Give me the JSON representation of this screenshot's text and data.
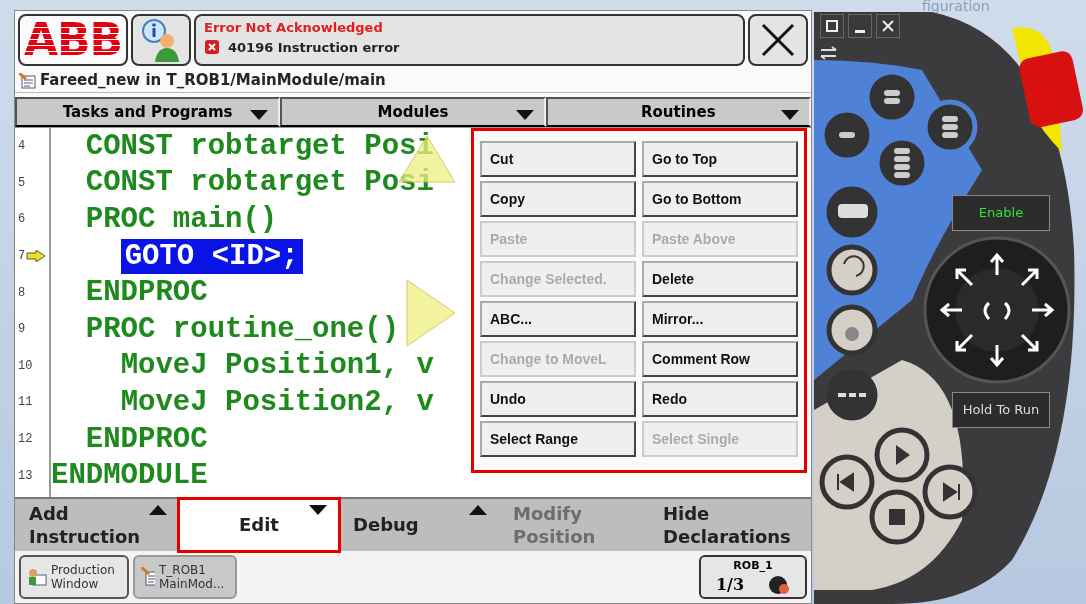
{
  "header": {
    "logo": "ABB",
    "event_title": "Error Not Acknowledged",
    "event_message": "40196 Instruction error"
  },
  "path": "Fareed_new in T_ROB1/MainModule/main",
  "dropdowns": [
    {
      "label": "Tasks and Programs"
    },
    {
      "label": "Modules"
    },
    {
      "label": "Routines"
    }
  ],
  "code_lines": [
    {
      "number": "4",
      "text": "  CONST robtarget Posi",
      "selected": false,
      "program_pointer": false
    },
    {
      "number": "5",
      "text": "  CONST robtarget Posi",
      "selected": false,
      "program_pointer": false
    },
    {
      "number": "6",
      "text": "  PROC main()",
      "selected": false,
      "program_pointer": false
    },
    {
      "number": "7",
      "text": "    GOTO <ID>;",
      "selected": true,
      "program_pointer": true
    },
    {
      "number": "8",
      "text": "  ENDPROC",
      "selected": false,
      "program_pointer": false
    },
    {
      "number": "9",
      "text": "  PROC routine_one()",
      "selected": false,
      "program_pointer": false
    },
    {
      "number": "10",
      "text": "    MoveJ Position1, v",
      "selected": false,
      "program_pointer": false
    },
    {
      "number": "11",
      "text": "    MoveJ Position2, v",
      "selected": false,
      "program_pointer": false
    },
    {
      "number": "12",
      "text": "  ENDPROC",
      "selected": false,
      "program_pointer": false
    },
    {
      "number": "13",
      "text": "ENDMODULE",
      "selected": false,
      "program_pointer": false
    }
  ],
  "edit_menu": {
    "highlighted": true,
    "items": [
      {
        "label": "Cut",
        "disabled": false
      },
      {
        "label": "Go to Top",
        "disabled": false
      },
      {
        "label": "Copy",
        "disabled": false
      },
      {
        "label": "Go to Bottom",
        "disabled": false
      },
      {
        "label": "Paste",
        "disabled": true
      },
      {
        "label": "Paste Above",
        "disabled": true
      },
      {
        "label": "Change Selected.",
        "disabled": true
      },
      {
        "label": "Delete",
        "disabled": false
      },
      {
        "label": "ABC...",
        "disabled": false
      },
      {
        "label": "Mirror...",
        "disabled": false
      },
      {
        "label": "Change to MoveL",
        "disabled": true
      },
      {
        "label": "Comment Row",
        "disabled": false
      },
      {
        "label": "Undo",
        "disabled": false
      },
      {
        "label": "Redo",
        "disabled": false
      },
      {
        "label": "Select Range",
        "disabled": false
      },
      {
        "label": "Select Single",
        "disabled": true
      }
    ]
  },
  "toolbar": [
    {
      "label": "Add Instruction",
      "kind": "popup_up",
      "disabled": false,
      "selected": false,
      "highlighted": false
    },
    {
      "label": "Edit",
      "kind": "popup_down",
      "disabled": false,
      "selected": true,
      "highlighted": true
    },
    {
      "label": "Debug",
      "kind": "popup_up",
      "disabled": false,
      "selected": false,
      "highlighted": false
    },
    {
      "label": "Modify Position",
      "kind": "command",
      "disabled": true,
      "selected": false,
      "highlighted": false
    },
    {
      "label": "Hide Declarations",
      "kind": "command",
      "disabled": false,
      "selected": false,
      "highlighted": false
    }
  ],
  "taskbar": [
    {
      "kind": "production",
      "label": "Production Window",
      "selected": false
    },
    {
      "kind": "program",
      "label": "T_ROB1 MainMod...",
      "selected": true
    }
  ],
  "status": {
    "unit": "ROB_1",
    "increment": "1/3"
  },
  "pendant": {
    "window_fragment": "figuration",
    "enable_label": "Enable",
    "hold_to_run_label": "Hold To Run"
  }
}
